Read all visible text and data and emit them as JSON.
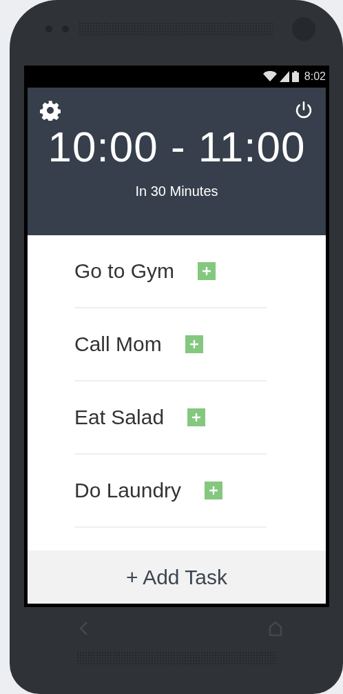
{
  "status_bar": {
    "time": "8:02"
  },
  "header": {
    "time_range": "10:00 - 11:00",
    "subtitle": "In 30 Minutes"
  },
  "tasks": [
    {
      "label": "Go to Gym"
    },
    {
      "label": "Call Mom"
    },
    {
      "label": "Eat Salad"
    },
    {
      "label": "Do Laundry"
    }
  ],
  "add_button": {
    "label": "+ Add Task"
  }
}
